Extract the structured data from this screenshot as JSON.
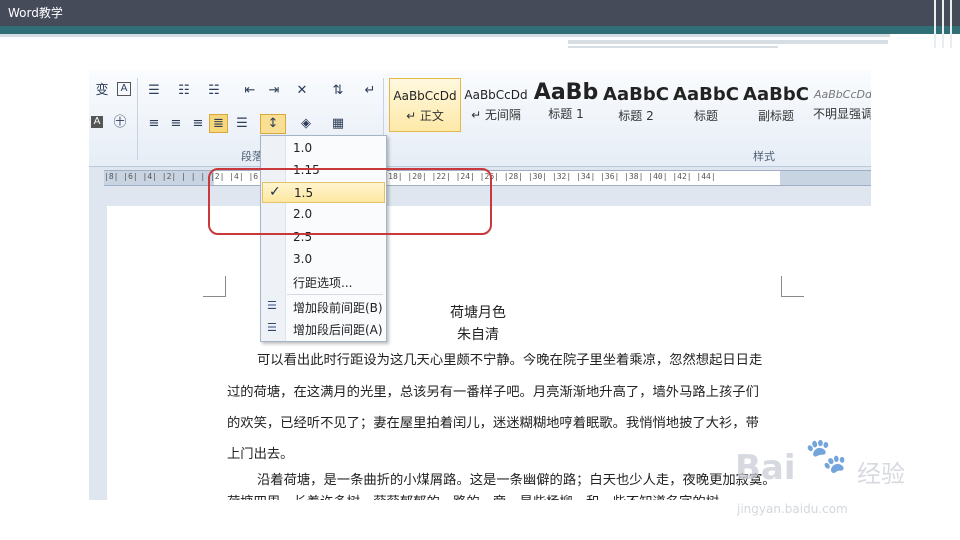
{
  "slide": {
    "title": "Word教学"
  },
  "ribbon": {
    "paragraph_group_label": "段落",
    "styles_group_label": "样式",
    "styles": [
      {
        "sample": "AaBbCcDd",
        "name": "↵ 正文"
      },
      {
        "sample": "AaBbCcDd",
        "name": "↵ 无间隔"
      },
      {
        "sample": "AaBb",
        "name": "标题 1"
      },
      {
        "sample": "AaBbC",
        "name": "标题 2"
      },
      {
        "sample": "AaBbC",
        "name": "标题"
      },
      {
        "sample": "AaBbC",
        "name": "副标题"
      },
      {
        "sample": "AaBbCcDd",
        "name": "不明显强调"
      }
    ]
  },
  "ruler": {
    "ticks": "|8| |6| |4| |2| | | | |2| |4| |6| |8| |10| |12| |14| |16| |18| |20| |22| |24| |26| |28| |30| |32| |34| |36| |38| |40| |42| |44|"
  },
  "line_spacing_menu": {
    "items": [
      "1.0",
      "1.15",
      "1.5",
      "2.0",
      "2.5",
      "3.0"
    ],
    "selected": "1.5",
    "checkmark": "✓",
    "options_label": "行距选项...",
    "add_before_label": "增加段前间距(B)",
    "add_after_label": "增加段后间距(A)"
  },
  "document": {
    "title": "荷塘月色",
    "author": "朱自清",
    "lines": [
      "可以看出此时行距设为这几天心里颇不宁静。今晚在院子里坐着乘凉，忽然想起日日走",
      "过的荷塘，在这满月的光里，总该另有一番样子吧。月亮渐渐地升高了，墙外马路上孩子们",
      "的欢笑，已经听不见了；妻在屋里拍着闰儿，迷迷糊糊地哼着眠歌。我悄悄地披了大衫，带",
      "上门出去。",
      "沿着荷塘，是一条曲折的小煤屑路。这是一条幽僻的路；白天也少人走，夜晚更加寂寞。",
      "荷塘四周，长着许多树，蓊蓊郁郁的。路的一旁，是些杨柳，和一些不知道名字的树"
    ]
  },
  "watermark": {
    "brand": "Bai",
    "brand_cn": "经验",
    "url": "jingyan.baidu.com"
  },
  "colors": {
    "highlight": "#fde7a0",
    "annotation_red": "#c9383a",
    "slide_bar": "#464b5a"
  }
}
